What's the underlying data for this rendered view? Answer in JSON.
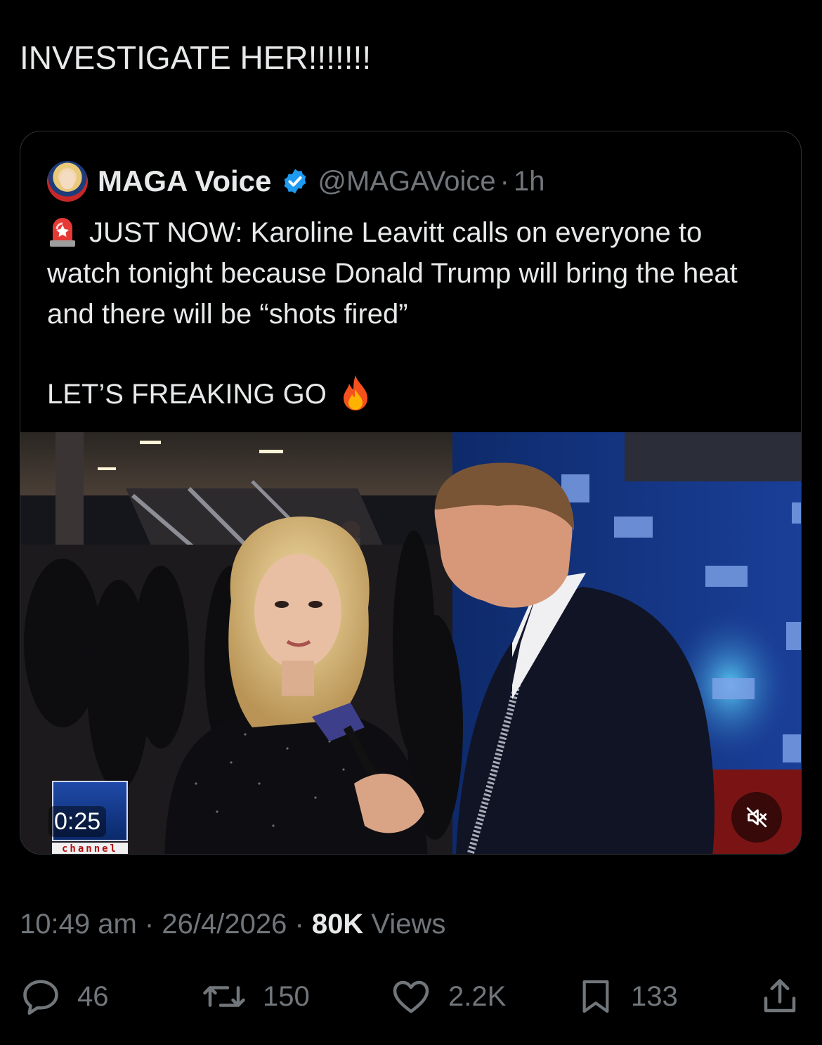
{
  "post": {
    "text": "INVESTIGATE HER!!!!!!!"
  },
  "quoted": {
    "display_name": "MAGA Voice",
    "handle": "@MAGAVoice",
    "separator": "·",
    "time_ago": "1h",
    "body_line": "JUST NOW: Karoline Leavitt calls on everyone to watch tonight because Donald Trump will bring the heat and there will be “shots fired”",
    "body_line2": "LET’S FREAKING GO",
    "video": {
      "duration": "0:25",
      "channel_strip": "channel",
      "muted": true
    }
  },
  "meta": {
    "time": "10:49 am",
    "sep1": "·",
    "date": "26/4/2026",
    "sep2": "·",
    "views_count": "80K",
    "views_label": "Views"
  },
  "actions": {
    "replies": "46",
    "reposts": "150",
    "likes": "2.2K",
    "bookmarks": "133"
  },
  "colors": {
    "background": "#000000",
    "text": "#e7e9ea",
    "muted_text": "#71767b",
    "verified_blue": "#1d9bf0",
    "border": "#2f3336"
  },
  "icons": [
    "verified-badge-icon",
    "siren-emoji-icon",
    "fire-emoji-icon",
    "mute-icon",
    "reply-icon",
    "repost-icon",
    "like-icon",
    "bookmark-icon",
    "share-icon"
  ]
}
